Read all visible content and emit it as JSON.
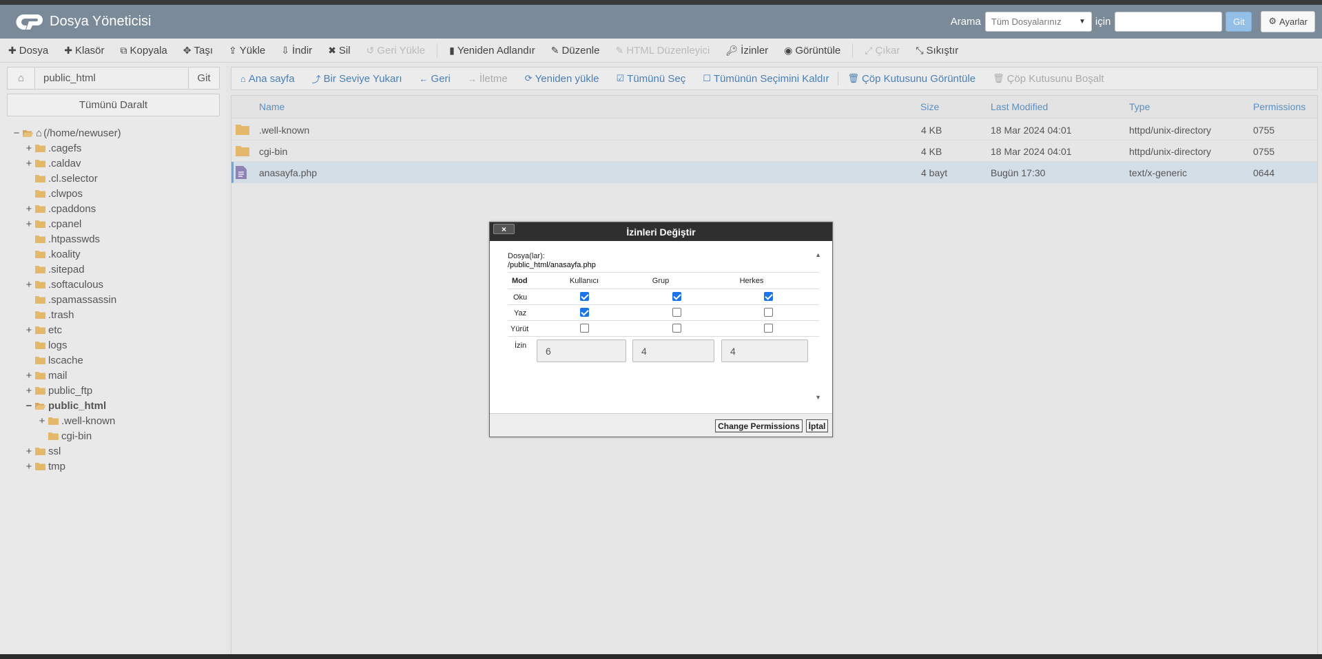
{
  "header": {
    "app_title": "Dosya Yöneticisi",
    "search_label": "Arama",
    "search_scope": "Tüm Dosyalarınız",
    "for_label": "için",
    "go_label": "Git",
    "settings_label": "Ayarlar"
  },
  "toolbar": {
    "file": "Dosya",
    "folder": "Klasör",
    "copy": "Kopyala",
    "move": "Taşı",
    "upload": "Yükle",
    "download": "İndir",
    "delete": "Sil",
    "restore": "Geri Yükle",
    "rename": "Yeniden Adlandır",
    "edit": "Düzenle",
    "html_editor": "HTML Düzenleyici",
    "permissions": "İzinler",
    "view": "Görüntüle",
    "extract": "Çıkar",
    "compress": "Sıkıştır"
  },
  "sidebar": {
    "path_value": "public_html",
    "go_label": "Git",
    "collapse_label": "Tümünü Daralt",
    "tree": [
      {
        "toggle": "−",
        "label": "(/home/newuser)",
        "home": true
      },
      {
        "toggle": "+",
        "label": ".cagefs"
      },
      {
        "toggle": "+",
        "label": ".caldav"
      },
      {
        "toggle": "",
        "label": ".cl.selector"
      },
      {
        "toggle": "",
        "label": ".clwpos"
      },
      {
        "toggle": "+",
        "label": ".cpaddons"
      },
      {
        "toggle": "+",
        "label": ".cpanel"
      },
      {
        "toggle": "",
        "label": ".htpasswds"
      },
      {
        "toggle": "",
        "label": ".koality"
      },
      {
        "toggle": "",
        "label": ".sitepad"
      },
      {
        "toggle": "+",
        "label": ".softaculous"
      },
      {
        "toggle": "",
        "label": ".spamassassin"
      },
      {
        "toggle": "",
        "label": ".trash"
      },
      {
        "toggle": "+",
        "label": "etc"
      },
      {
        "toggle": "",
        "label": "logs"
      },
      {
        "toggle": "",
        "label": "lscache"
      },
      {
        "toggle": "+",
        "label": "mail"
      },
      {
        "toggle": "+",
        "label": "public_ftp"
      },
      {
        "toggle": "−",
        "label": "public_html",
        "bold": true
      },
      {
        "toggle": "+",
        "label": ".well-known",
        "child": true
      },
      {
        "toggle": "",
        "label": "cgi-bin",
        "child": true
      },
      {
        "toggle": "+",
        "label": "ssl"
      },
      {
        "toggle": "+",
        "label": "tmp"
      }
    ]
  },
  "subtoolbar": {
    "home": "Ana sayfa",
    "up_one_level": "Bir Seviye Yukarı",
    "back": "Geri",
    "forward": "İletme",
    "reload": "Yeniden yükle",
    "select_all": "Tümünü Seç",
    "unselect_all": "Tümünün Seçimini Kaldır",
    "view_trash": "Çöp Kutusunu Görüntüle",
    "empty_trash": "Çöp Kutusunu Boşalt"
  },
  "files": {
    "columns": [
      "Name",
      "Size",
      "Last Modified",
      "Type",
      "Permissions"
    ],
    "rows": [
      {
        "name": ".well-known",
        "size": "4 KB",
        "modified": "18 Mar 2024 04:01",
        "type": "httpd/unix-directory",
        "perms": "0755",
        "kind": "folder"
      },
      {
        "name": "cgi-bin",
        "size": "4 KB",
        "modified": "18 Mar 2024 04:01",
        "type": "httpd/unix-directory",
        "perms": "0755",
        "kind": "folder"
      },
      {
        "name": "anasayfa.php",
        "size": "4 bayt",
        "modified": "Bugün 17:30",
        "type": "text/x-generic",
        "perms": "0644",
        "kind": "file",
        "selected": true
      }
    ]
  },
  "dialog": {
    "title": "İzinleri Değiştir",
    "close_label": "×",
    "files_label": "Dosya(lar):",
    "files_value": "/public_html/anasayfa.php",
    "mode_label": "Mod",
    "user_label": "Kullanıcı",
    "group_label": "Grup",
    "world_label": "Herkes",
    "read_label": "Oku",
    "write_label": "Yaz",
    "execute_label": "Yürüt",
    "permission_label": "İzin",
    "user_value": "6",
    "group_value": "4",
    "world_value": "4",
    "change_button": "Change Permissions",
    "cancel_button": "İptal",
    "checks": {
      "read": [
        true,
        true,
        true
      ],
      "write": [
        true,
        false,
        false
      ],
      "execute": [
        false,
        false,
        false
      ]
    }
  },
  "colors": {
    "header_bg": "#7a8a99",
    "link_blue": "#4a7fb5",
    "folder": "#e3b86b",
    "checkbox": "#1a73e8"
  }
}
